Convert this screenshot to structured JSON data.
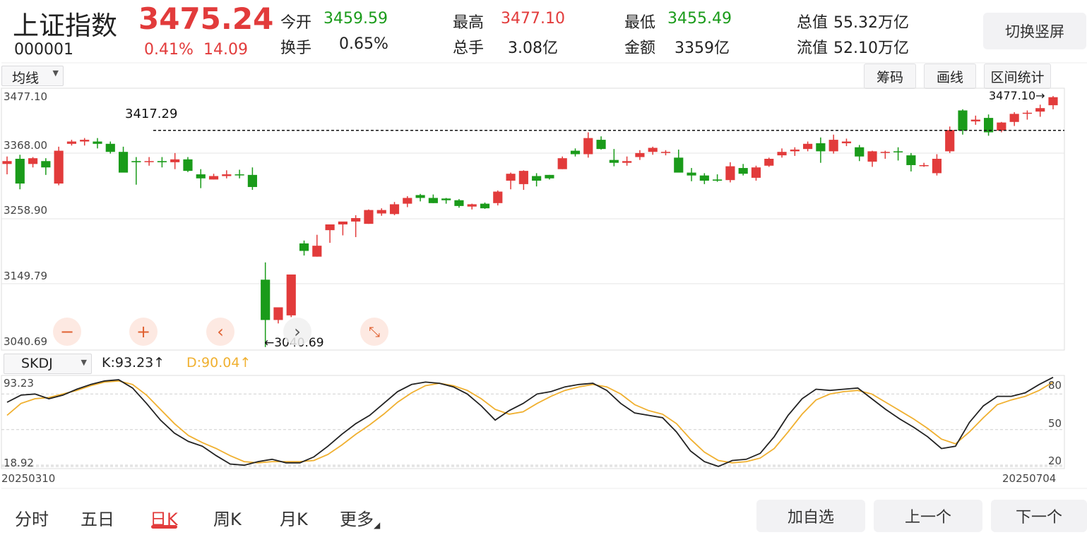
{
  "header": {
    "name": "上证指数",
    "code": "000001",
    "price": "3475.24",
    "change_pct": "0.41%",
    "change": "14.09",
    "stats": [
      {
        "label": "今开",
        "value": "3459.59",
        "color": "green"
      },
      {
        "label": "换手",
        "value": "0.65%",
        "color": "normal"
      },
      {
        "label": "最高",
        "value": "3477.10",
        "color": "red"
      },
      {
        "label": "总手",
        "value": "3.08亿",
        "color": "normal"
      },
      {
        "label": "最低",
        "value": "3455.49",
        "color": "green"
      },
      {
        "label": "金额",
        "value": "3359亿",
        "color": "normal"
      },
      {
        "label": "总值",
        "value": "55.32万亿",
        "color": "normal"
      },
      {
        "label": "流值",
        "value": "52.10万亿",
        "color": "normal"
      }
    ],
    "switch_label": "切换竖屏"
  },
  "toolbar": {
    "ma_select": "均线",
    "chips": "筹码",
    "draw": "画线",
    "range_stats": "区间统计"
  },
  "indicator": {
    "select": "SKDJ",
    "k_text": "K:93.23",
    "d_text": "D:90.04",
    "up_arrow": "↑"
  },
  "colors": {
    "up": "#e23b3b",
    "down": "#1a9b1a",
    "k_line": "#222222",
    "d_line": "#f0b030"
  },
  "controls": {
    "zoom_out": "−",
    "zoom_in": "+",
    "prev": "‹",
    "next": "›",
    "shrink": "⤡"
  },
  "chart_data": [
    {
      "type": "candlestick",
      "title": "",
      "ylim": [
        3040.69,
        3477.1
      ],
      "y_ticks": [
        "3477.10",
        "3368.00",
        "3258.90",
        "3149.79",
        "3040.69"
      ],
      "reference_line": {
        "value": 3417.29,
        "label": "3417.29"
      },
      "high_marker": "3477.10→",
      "low_marker": "←3040.69",
      "ohlc": [
        [
          3359,
          3372,
          3341,
          3364
        ],
        [
          3368,
          3375,
          3315,
          3325
        ],
        [
          3359,
          3371,
          3353,
          3369
        ],
        [
          3364,
          3369,
          3340,
          3353
        ],
        [
          3325,
          3389,
          3322,
          3382
        ],
        [
          3394,
          3401,
          3391,
          3398
        ],
        [
          3398,
          3404,
          3391,
          3401
        ],
        [
          3398,
          3404,
          3386,
          3394
        ],
        [
          3394,
          3398,
          3377,
          3380
        ],
        [
          3380,
          3389,
          3356,
          3344
        ],
        [
          3364,
          3371,
          3323,
          3362
        ],
        [
          3364,
          3371,
          3356,
          3364
        ],
        [
          3364,
          3371,
          3353,
          3362
        ],
        [
          3362,
          3378,
          3350,
          3367
        ],
        [
          3367,
          3371,
          3345,
          3347
        ],
        [
          3341,
          3350,
          3317,
          3334
        ],
        [
          3332,
          3342,
          3332,
          3338
        ],
        [
          3338,
          3348,
          3334,
          3341
        ],
        [
          3341,
          3349,
          3334,
          3340
        ],
        [
          3340,
          3353,
          3314,
          3319
        ],
        [
          3158,
          3188,
          3041,
          3088
        ],
        [
          3088,
          3108,
          3082,
          3110
        ],
        [
          3096,
          3164,
          3093,
          3167
        ],
        [
          3221,
          3226,
          3200,
          3208
        ],
        [
          3198,
          3236,
          3198,
          3217
        ],
        [
          3244,
          3246,
          3222,
          3254
        ],
        [
          3254,
          3257,
          3235,
          3259
        ],
        [
          3259,
          3270,
          3232,
          3265
        ],
        [
          3255,
          3280,
          3255,
          3279
        ],
        [
          3273,
          3282,
          3269,
          3279
        ],
        [
          3272,
          3293,
          3270,
          3289
        ],
        [
          3290,
          3303,
          3284,
          3300
        ],
        [
          3305,
          3307,
          3294,
          3300
        ],
        [
          3300,
          3306,
          3291,
          3291
        ],
        [
          3299,
          3300,
          3290,
          3296
        ],
        [
          3296,
          3298,
          3283,
          3286
        ],
        [
          3285,
          3290,
          3280,
          3289
        ],
        [
          3290,
          3292,
          3281,
          3282
        ],
        [
          3291,
          3313,
          3287,
          3311
        ],
        [
          3330,
          3344,
          3315,
          3342
        ],
        [
          3324,
          3348,
          3314,
          3347
        ],
        [
          3338,
          3343,
          3320,
          3330
        ],
        [
          3340,
          3340,
          3332,
          3334
        ],
        [
          3350,
          3372,
          3350,
          3369
        ],
        [
          3382,
          3386,
          3372,
          3376
        ],
        [
          3376,
          3414,
          3370,
          3404
        ],
        [
          3401,
          3407,
          3384,
          3385
        ],
        [
          3366,
          3385,
          3355,
          3361
        ],
        [
          3361,
          3372,
          3356,
          3364
        ],
        [
          3371,
          3383,
          3366,
          3378
        ],
        [
          3380,
          3389,
          3375,
          3387
        ],
        [
          3380,
          3383,
          3374,
          3380
        ],
        [
          3370,
          3384,
          3362,
          3344
        ],
        [
          3344,
          3352,
          3329,
          3339
        ],
        [
          3339,
          3343,
          3324,
          3330
        ],
        [
          3332,
          3341,
          3328,
          3330
        ],
        [
          3331,
          3362,
          3327,
          3355
        ],
        [
          3352,
          3359,
          3339,
          3342
        ],
        [
          3335,
          3356,
          3330,
          3353
        ],
        [
          3356,
          3370,
          3354,
          3368
        ],
        [
          3374,
          3386,
          3370,
          3380
        ],
        [
          3381,
          3388,
          3373,
          3384
        ],
        [
          3385,
          3398,
          3381,
          3394
        ],
        [
          3395,
          3405,
          3361,
          3381
        ],
        [
          3381,
          3410,
          3377,
          3401
        ],
        [
          3395,
          3403,
          3390,
          3398
        ],
        [
          3388,
          3392,
          3364,
          3372
        ],
        [
          3363,
          3382,
          3354,
          3381
        ],
        [
          3380,
          3382,
          3368,
          3380
        ],
        [
          3381,
          3388,
          3365,
          3380
        ],
        [
          3374,
          3378,
          3346,
          3357
        ],
        [
          3357,
          3361,
          3354,
          3357
        ],
        [
          3343,
          3376,
          3339,
          3368
        ],
        [
          3381,
          3424,
          3378,
          3418
        ],
        [
          3452,
          3454,
          3410,
          3417
        ],
        [
          3433,
          3443,
          3427,
          3436
        ],
        [
          3439,
          3445,
          3408,
          3414
        ],
        [
          3417,
          3432,
          3414,
          3431
        ],
        [
          3432,
          3449,
          3425,
          3446
        ],
        [
          3447,
          3452,
          3436,
          3448
        ],
        [
          3450,
          3462,
          3441,
          3456
        ],
        [
          3461,
          3477,
          3454,
          3475
        ]
      ],
      "colors": {
        "up": "#e23b3b",
        "down": "#1a9b1a"
      }
    },
    {
      "type": "line",
      "title": "SKDJ",
      "ylim": [
        18.92,
        93.23
      ],
      "y_ticks_left": [
        "93.23",
        "18.92"
      ],
      "y_ticks_right": [
        "80",
        "50",
        "20"
      ],
      "x_labels": [
        "20250310",
        "20250704"
      ],
      "series": [
        {
          "name": "K",
          "color": "#222222",
          "values": [
            73,
            79,
            80,
            76,
            79,
            84,
            88,
            91,
            92,
            85,
            72,
            58,
            47,
            40,
            36,
            28,
            21,
            20,
            23,
            25,
            22,
            22,
            27,
            36,
            46,
            55,
            62,
            72,
            82,
            88,
            90,
            89,
            86,
            80,
            70,
            58,
            66,
            72,
            80,
            82,
            86,
            88,
            89,
            83,
            72,
            64,
            62,
            60,
            48,
            32,
            23,
            19,
            24,
            25,
            30,
            44,
            62,
            76,
            84,
            83,
            84,
            85,
            76,
            67,
            59,
            52,
            44,
            34,
            36,
            56,
            70,
            78,
            78,
            81,
            88,
            94
          ]
        },
        {
          "name": "D",
          "color": "#f0b030",
          "values": [
            62,
            72,
            76,
            77,
            80,
            83,
            87,
            90,
            91,
            88,
            79,
            67,
            55,
            45,
            39,
            34,
            28,
            23,
            22,
            23,
            23,
            23,
            24,
            29,
            37,
            46,
            54,
            63,
            73,
            81,
            87,
            89,
            87,
            83,
            76,
            67,
            63,
            65,
            72,
            78,
            83,
            86,
            88,
            86,
            80,
            71,
            66,
            63,
            55,
            42,
            31,
            24,
            22,
            23,
            26,
            34,
            48,
            63,
            75,
            80,
            82,
            83,
            80,
            73,
            66,
            59,
            51,
            42,
            38,
            48,
            60,
            71,
            75,
            78,
            83,
            90
          ]
        }
      ]
    }
  ],
  "bottom_nav": {
    "tabs": [
      "分时",
      "五日",
      "日K",
      "周K",
      "月K",
      "更多"
    ],
    "active": 2,
    "add_watch": "加自选",
    "prev": "上一个",
    "next": "下一个"
  }
}
